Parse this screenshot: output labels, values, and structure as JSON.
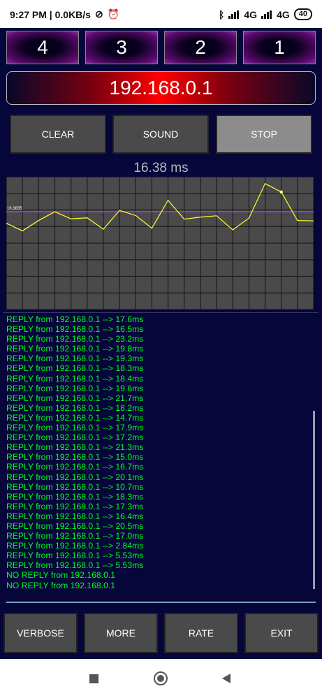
{
  "status_bar": {
    "time_speed": "9:27 PM | 0.0KB/s",
    "network_1": "4G",
    "network_2": "4G",
    "battery": "40"
  },
  "targets": [
    "4",
    "3",
    "2",
    "1"
  ],
  "ip_address": "192.168.0.1",
  "controls": {
    "clear": "CLEAR",
    "sound": "SOUND",
    "stop": "STOP"
  },
  "latency_display": "16.38 ms",
  "chart_data": {
    "type": "line",
    "reference_label": "16.3835",
    "reference_value": 16.3835,
    "grid": true,
    "series": [
      {
        "values": [
          19.8,
          22.1,
          19.0,
          16.4,
          18.5,
          18.2,
          21.6,
          16.0,
          17.5,
          21.3,
          13.0,
          18.6,
          18.0,
          17.6,
          21.8,
          18.3,
          8.0,
          10.5,
          19.0,
          19.1
        ],
        "color": "#ffff33"
      }
    ],
    "reference_color": "#cc33ff"
  },
  "log_lines": [
    "REPLY from 192.168.0.1 --> 17.6ms",
    "REPLY from 192.168.0.1 --> 16.5ms",
    "REPLY from 192.168.0.1 --> 23.2ms",
    "REPLY from 192.168.0.1 --> 19.8ms",
    "REPLY from 192.168.0.1 --> 19.3ms",
    "REPLY from 192.168.0.1 --> 18.3ms",
    "REPLY from 192.168.0.1 --> 18.4ms",
    "REPLY from 192.168.0.1 --> 19.6ms",
    "REPLY from 192.168.0.1 --> 21.7ms",
    "REPLY from 192.168.0.1 --> 18.2ms",
    "REPLY from 192.168.0.1 --> 14.7ms",
    "REPLY from 192.168.0.1 --> 17.9ms",
    "REPLY from 192.168.0.1 --> 17.2ms",
    "REPLY from 192.168.0.1 --> 21.3ms",
    "REPLY from 192.168.0.1 --> 15.0ms",
    "REPLY from 192.168.0.1 --> 16.7ms",
    "REPLY from 192.168.0.1 --> 20.1ms",
    "REPLY from 192.168.0.1 --> 10.7ms",
    "REPLY from 192.168.0.1 --> 18.3ms",
    "REPLY from 192.168.0.1 --> 17.3ms",
    "REPLY from 192.168.0.1 --> 16.4ms",
    "REPLY from 192.168.0.1 --> 20.5ms",
    "REPLY from 192.168.0.1 --> 17.0ms",
    "REPLY from 192.168.0.1 --> 2.84ms",
    "REPLY from 192.168.0.1 --> 5.53ms",
    "REPLY from 192.168.0.1 --> 5.53ms",
    "NO REPLY from 192.168.0.1",
    "NO REPLY from 192.168.0.1"
  ],
  "bottom_buttons": {
    "verbose": "VERBOSE",
    "more": "MORE",
    "rate": "RATE",
    "exit": "EXIT"
  },
  "icons": [
    "wifi-off-icon",
    "alarm-icon",
    "bluetooth-icon",
    "signal-icon",
    "battery-icon",
    "nav-recents-icon",
    "nav-home-icon",
    "nav-back-icon"
  ]
}
